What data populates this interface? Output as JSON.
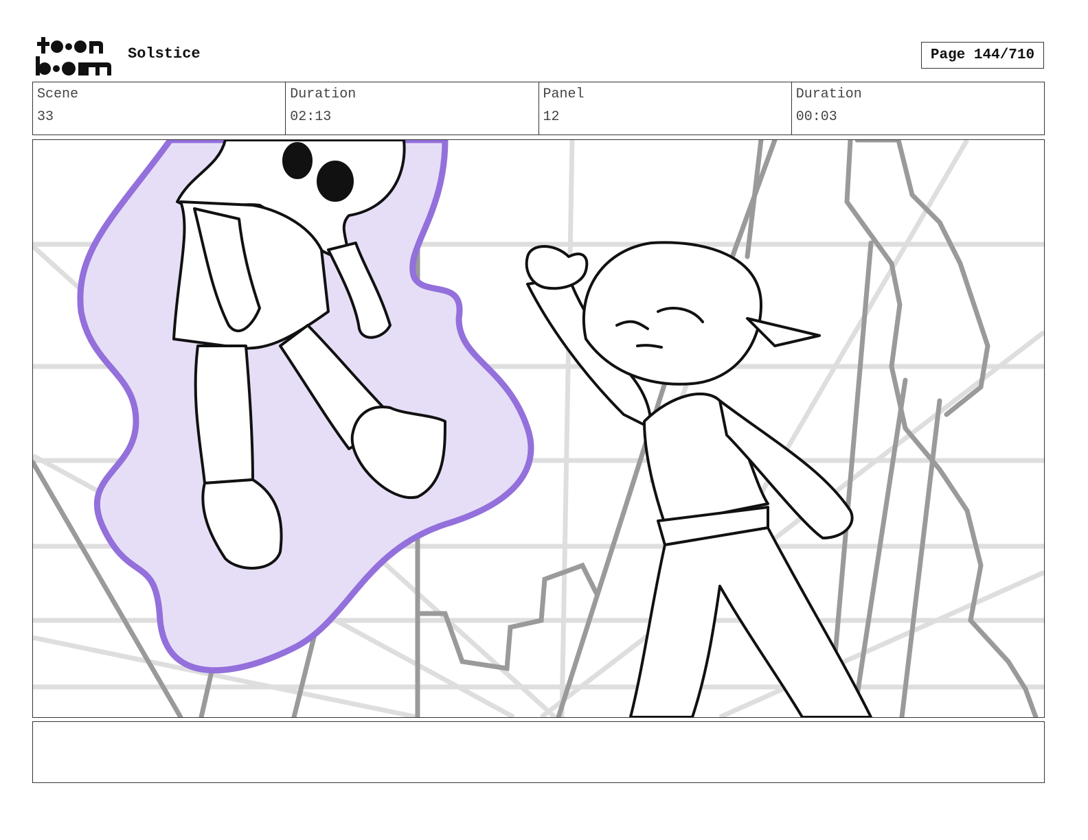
{
  "header": {
    "logo": {
      "brand_text": "toon boom",
      "icon": "toon-boom-logo"
    },
    "project_title": "Solstice",
    "page_counter": "Page 144/710"
  },
  "info_table": {
    "cells": [
      {
        "label": "Scene",
        "value": "33"
      },
      {
        "label": "Duration",
        "value": "02:13"
      },
      {
        "label": "Panel",
        "value": "12"
      },
      {
        "label": "Duration",
        "value": "00:03"
      }
    ]
  },
  "panel": {
    "description_icon": "storyboard-sketch",
    "colors": {
      "aura_fill": "#e4dcf5",
      "aura_stroke": "#9370db",
      "line_art": "#111111",
      "perspective_grid": "#dcdcdc",
      "background_structures": "#999999"
    }
  },
  "notes": {
    "text": ""
  }
}
